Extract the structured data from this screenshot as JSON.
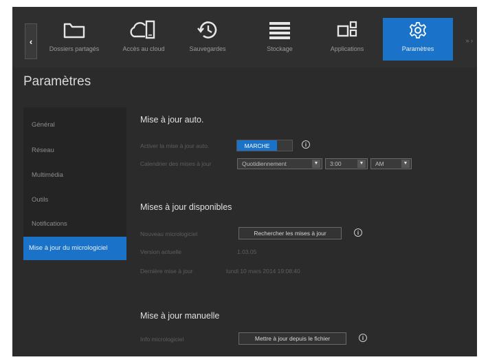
{
  "nav": {
    "back_symbol": "‹",
    "items": [
      {
        "label": "Dossiers partagés",
        "icon": "folder-icon"
      },
      {
        "label": "Accès au cloud",
        "icon": "cloud-device-icon"
      },
      {
        "label": "Sauvegardes",
        "icon": "history-icon"
      },
      {
        "label": "Stockage",
        "icon": "storage-icon"
      },
      {
        "label": "Applications",
        "icon": "apps-icon"
      },
      {
        "label": "Paramètres",
        "icon": "gear-icon"
      }
    ],
    "more_symbol": "» ›"
  },
  "page_title": "Paramètres",
  "sidebar": {
    "items": [
      {
        "label": "Général"
      },
      {
        "label": "Réseau"
      },
      {
        "label": "Multimédia"
      },
      {
        "label": "Outils"
      },
      {
        "label": "Notifications"
      },
      {
        "label": "Mise à jour du micrologiciel"
      }
    ]
  },
  "auto_update": {
    "title": "Mise à jour auto.",
    "enable_label": "Activer la mise à jour auto.",
    "toggle_on": "MARCHE",
    "schedule_label": "Calendrier des mises à jour",
    "frequency": "Quotidiennement",
    "time": "3:00",
    "ampm": "AM"
  },
  "available": {
    "title": "Mises à jour disponibles",
    "new_firmware_label": "Nouveau micrologiciel",
    "check_button": "Rechercher les mises à jour",
    "current_version_label": "Version actuelle",
    "current_version_value": "1.03.05",
    "last_check_label": "Dernière mise à jour",
    "last_check_value": "lundi 10 mars 2014 19:08:40"
  },
  "manual": {
    "title": "Mise à jour manuelle",
    "firmware_label": "Info micrologiciel",
    "update_button": "Mettre à jour depuis le fichier"
  },
  "info_symbol": "i",
  "colors": {
    "accent": "#1a73c8",
    "background": "#2b2b2b"
  }
}
